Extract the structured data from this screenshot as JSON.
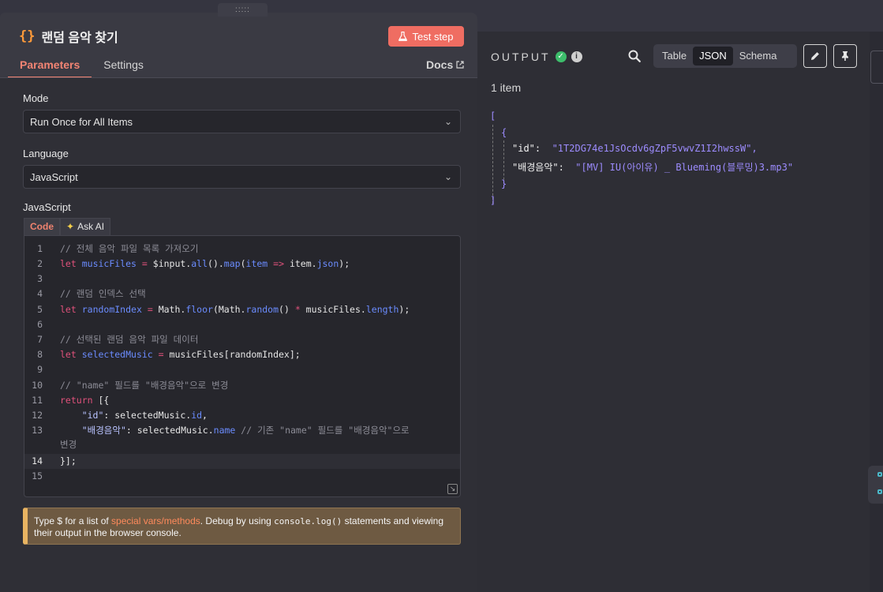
{
  "node": {
    "title": "랜덤 음악 찾기",
    "test_step_label": "Test step",
    "drag_handle": ":::::"
  },
  "tabs": [
    {
      "label": "Parameters",
      "active": true
    },
    {
      "label": "Settings",
      "active": false
    }
  ],
  "docs_label": "Docs",
  "mode": {
    "label": "Mode",
    "value": "Run Once for All Items"
  },
  "language": {
    "label": "Language",
    "value": "JavaScript"
  },
  "code_section": {
    "label": "JavaScript",
    "tab_code": "Code",
    "tab_ask_ai": "Ask AI",
    "lines": [
      {
        "n": "1",
        "text": "// 전체 음악 파일 목록 가져오기"
      },
      {
        "n": "2",
        "text": "let musicFiles = $input.all().map(item => item.json);"
      },
      {
        "n": "3",
        "text": ""
      },
      {
        "n": "4",
        "text": "// 랜덤 인덱스 선택"
      },
      {
        "n": "5",
        "text": "let randomIndex = Math.floor(Math.random() * musicFiles.length);"
      },
      {
        "n": "6",
        "text": ""
      },
      {
        "n": "7",
        "text": "// 선택된 랜덤 음악 파일 데이터"
      },
      {
        "n": "8",
        "text": "let selectedMusic = musicFiles[randomIndex];"
      },
      {
        "n": "9",
        "text": ""
      },
      {
        "n": "10",
        "text": "// \"name\" 필드를 \"배경음악\"으로 변경"
      },
      {
        "n": "11",
        "text": "return [{"
      },
      {
        "n": "12",
        "text": "    \"id\": selectedMusic.id,"
      },
      {
        "n": "13",
        "text": "    \"배경음악\": selectedMusic.name // 기존 \"name\" 필드를 \"배경음악\"으로"
      },
      {
        "n": "14",
        "text": "}];"
      },
      {
        "n": "15",
        "text": ""
      }
    ],
    "wrapped_tail": "변경"
  },
  "hint": {
    "part1": "Type $ for a list of ",
    "link": "special vars/methods",
    "part2": ". Debug by using ",
    "code": "console.log()",
    "part3": " statements and viewing their output in the browser console."
  },
  "output": {
    "label": "OUTPUT",
    "view_modes": [
      "Table",
      "JSON",
      "Schema"
    ],
    "active_view": "JSON",
    "items_count": "1 item",
    "json": {
      "open_bracket": "[",
      "open_brace": "{",
      "id_key": "\"id\":",
      "id_value": "\"1T2DG74e1JsOcdv6gZpF5vwvZ1I2hwssW\",",
      "bgm_key": "\"배경음악\":",
      "bgm_value": "\"[MV] IU(아이유) _ Blueming(블루밍)3.mp3\"",
      "close_brace": "}",
      "close_bracket": "]"
    }
  },
  "colors": {
    "accent": "#ef6d62",
    "active_tab": "#f28473",
    "json_value": "#9d8cff",
    "success": "#3dbd6b"
  }
}
